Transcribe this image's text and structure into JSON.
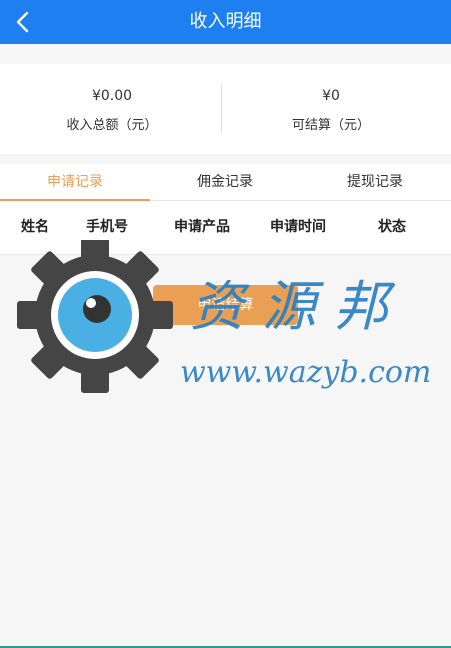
{
  "header": {
    "title": "收入明细",
    "back_icon": "chevron-left-icon",
    "background_color": "#1e7ff0"
  },
  "summary": {
    "total_income": {
      "amount": "¥0.00",
      "label": "收入总额（元）"
    },
    "settleable": {
      "amount": "¥0",
      "label": "可结算（元）"
    }
  },
  "tabs": [
    {
      "label": "申请记录",
      "active": true
    },
    {
      "label": "佣金记录",
      "active": false
    },
    {
      "label": "提现记录",
      "active": false
    }
  ],
  "table": {
    "columns": [
      "姓名",
      "手机号",
      "申请产品",
      "申请时间",
      "状态"
    ]
  },
  "apply_button": {
    "label": "申请结算"
  },
  "watermark": {
    "brand": "资源邦",
    "url": "www.wazyb.com",
    "icon": "gear-eye-logo-icon"
  },
  "colors": {
    "accent": "#e9a054",
    "brand_blue": "#1e7ff0"
  }
}
